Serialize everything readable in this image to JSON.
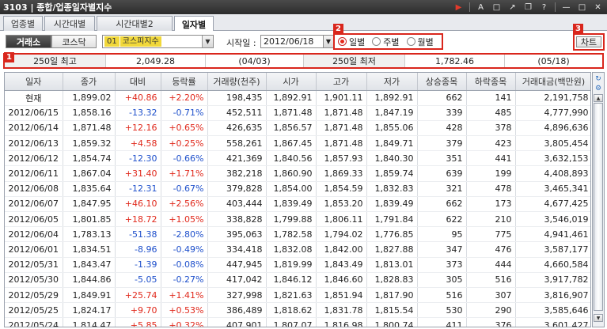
{
  "window": {
    "title": "3103 | 종합/업종일자별지수"
  },
  "tabs": [
    {
      "label": "업종별"
    },
    {
      "label": "시간대별"
    },
    {
      "label": "시간대별2"
    },
    {
      "label": "일자별"
    }
  ],
  "controls": {
    "market_kospi": "거래소",
    "market_kosdaq": "코스닥",
    "index_code": "01",
    "index_name": "코스피지수",
    "start_date_label": "시작일 :",
    "start_date": "2012/06/18",
    "period_daily": "일별",
    "period_weekly": "주별",
    "period_monthly": "월별",
    "chart_button": "차트",
    "badge_1": "1",
    "badge_2": "2",
    "badge_3": "3"
  },
  "summary": {
    "high_label": "250일 최고",
    "high_value": "2,049.28",
    "high_date": "(04/03)",
    "low_label": "250일 최저",
    "low_value": "1,782.46",
    "low_date": "(05/18)"
  },
  "table": {
    "headers": [
      "일자",
      "종가",
      "대비",
      "등락률",
      "거래량(천주)",
      "시가",
      "고가",
      "저가",
      "상승종목",
      "하락종목",
      "거래대금(백만원)"
    ],
    "rows": [
      [
        "현재",
        "1,899.02",
        "+40.86",
        "+2.20%",
        "198,435",
        "1,892.91",
        "1,901.11",
        "1,892.91",
        "662",
        "141",
        "2,191,758"
      ],
      [
        "2012/06/15",
        "1,858.16",
        "-13.32",
        "-0.71%",
        "452,511",
        "1,871.48",
        "1,871.48",
        "1,847.19",
        "339",
        "485",
        "4,777,990"
      ],
      [
        "2012/06/14",
        "1,871.48",
        "+12.16",
        "+0.65%",
        "426,635",
        "1,856.57",
        "1,871.48",
        "1,855.06",
        "428",
        "378",
        "4,896,636"
      ],
      [
        "2012/06/13",
        "1,859.32",
        "+4.58",
        "+0.25%",
        "558,261",
        "1,867.45",
        "1,871.48",
        "1,849.71",
        "379",
        "423",
        "3,805,454"
      ],
      [
        "2012/06/12",
        "1,854.74",
        "-12.30",
        "-0.66%",
        "421,369",
        "1,840.56",
        "1,857.93",
        "1,840.30",
        "351",
        "441",
        "3,632,153"
      ],
      [
        "2012/06/11",
        "1,867.04",
        "+31.40",
        "+1.71%",
        "382,218",
        "1,860.90",
        "1,869.33",
        "1,859.74",
        "639",
        "199",
        "4,408,893"
      ],
      [
        "2012/06/08",
        "1,835.64",
        "-12.31",
        "-0.67%",
        "379,828",
        "1,854.00",
        "1,854.59",
        "1,832.83",
        "321",
        "478",
        "3,465,341"
      ],
      [
        "2012/06/07",
        "1,847.95",
        "+46.10",
        "+2.56%",
        "403,444",
        "1,839.49",
        "1,853.20",
        "1,839.49",
        "662",
        "173",
        "4,677,425"
      ],
      [
        "2012/06/05",
        "1,801.85",
        "+18.72",
        "+1.05%",
        "338,828",
        "1,799.88",
        "1,806.11",
        "1,791.84",
        "622",
        "210",
        "3,546,019"
      ],
      [
        "2012/06/04",
        "1,783.13",
        "-51.38",
        "-2.80%",
        "395,063",
        "1,782.58",
        "1,794.02",
        "1,776.85",
        "95",
        "775",
        "4,941,461"
      ],
      [
        "2012/06/01",
        "1,834.51",
        "-8.96",
        "-0.49%",
        "334,418",
        "1,832.08",
        "1,842.00",
        "1,827.88",
        "347",
        "476",
        "3,587,177"
      ],
      [
        "2012/05/31",
        "1,843.47",
        "-1.39",
        "-0.08%",
        "447,945",
        "1,819.99",
        "1,843.49",
        "1,813.01",
        "373",
        "444",
        "4,660,584"
      ],
      [
        "2012/05/30",
        "1,844.86",
        "-5.05",
        "-0.27%",
        "417,042",
        "1,846.12",
        "1,846.60",
        "1,828.83",
        "305",
        "516",
        "3,917,782"
      ],
      [
        "2012/05/29",
        "1,849.91",
        "+25.74",
        "+1.41%",
        "327,998",
        "1,821.63",
        "1,851.94",
        "1,817.90",
        "516",
        "307",
        "3,816,907"
      ],
      [
        "2012/05/25",
        "1,824.17",
        "+9.70",
        "+0.53%",
        "386,489",
        "1,818.62",
        "1,831.78",
        "1,815.54",
        "530",
        "290",
        "3,585,646"
      ],
      [
        "2012/05/24",
        "1,814.47",
        "+5.85",
        "+0.32%",
        "407,901",
        "1,807.07",
        "1,816.98",
        "1,800.74",
        "411",
        "376",
        "3,601,427"
      ]
    ]
  },
  "colors": {
    "up": "#e0281b",
    "down": "#1d4fcb",
    "highlight_red": "#d9261c"
  }
}
